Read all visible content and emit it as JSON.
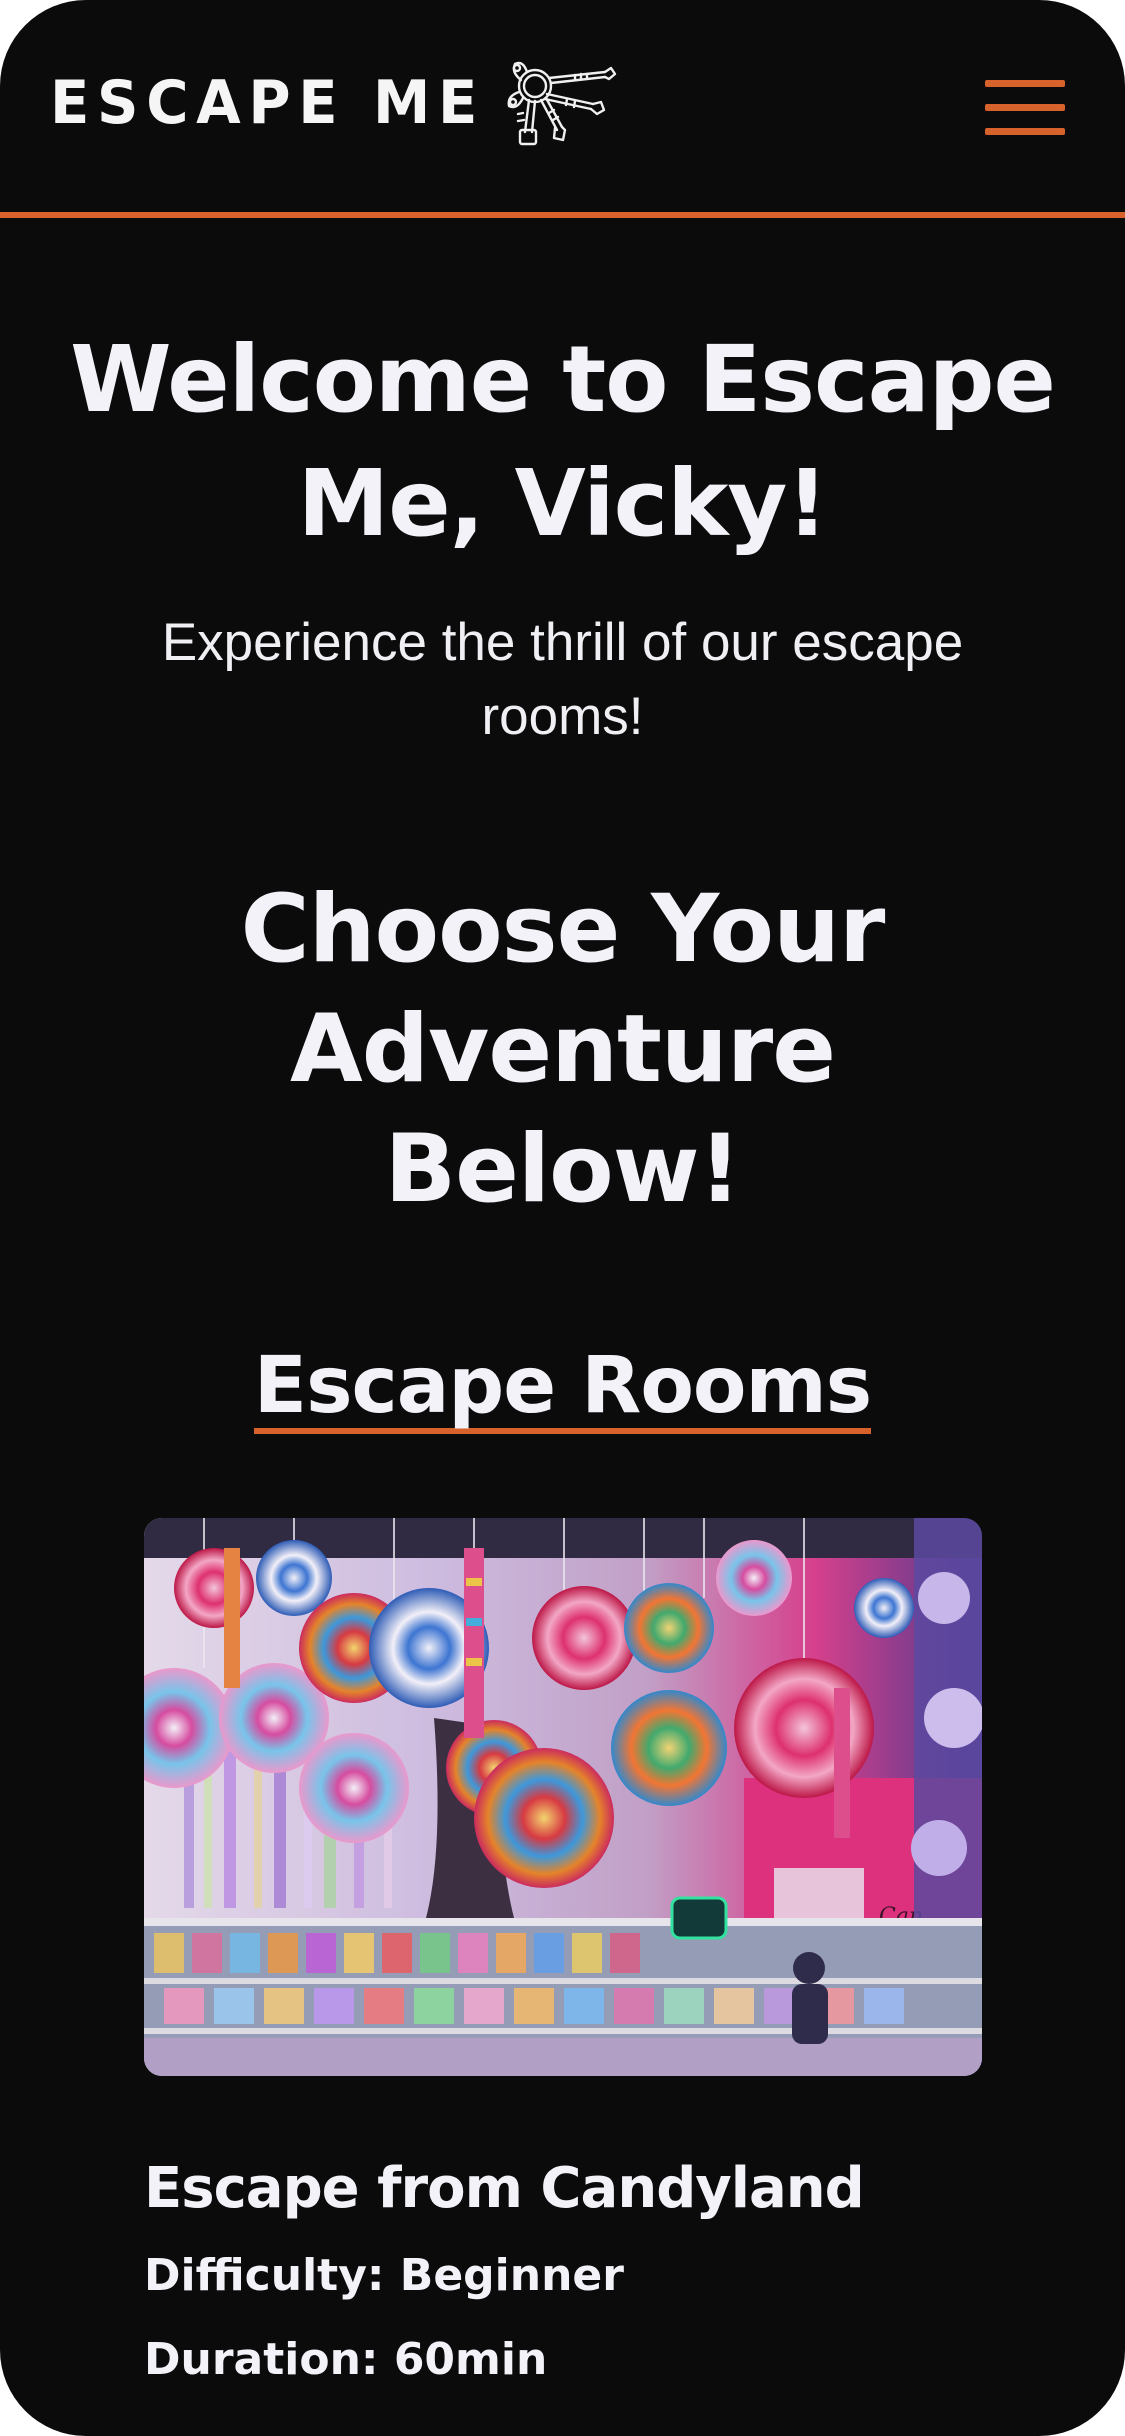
{
  "header": {
    "brand_name": "ESCAPE ME",
    "logo_icon": "keys-icon",
    "menu_icon": "hamburger-menu-icon"
  },
  "hero": {
    "title": "Welcome to Escape Me, Vicky!",
    "subtitle": "Experience the thrill of our escape rooms!"
  },
  "adventure": {
    "title": "Choose Your Adventure Below!"
  },
  "rooms_section": {
    "heading": "Escape Rooms",
    "rooms": [
      {
        "name": "Escape from Candyland",
        "difficulty": "Difficulty: Beginner",
        "duration": "Duration: 60min"
      }
    ]
  },
  "colors": {
    "background": "#0b0b0c",
    "accent": "#d8622b",
    "text": "#f2f2f8"
  }
}
